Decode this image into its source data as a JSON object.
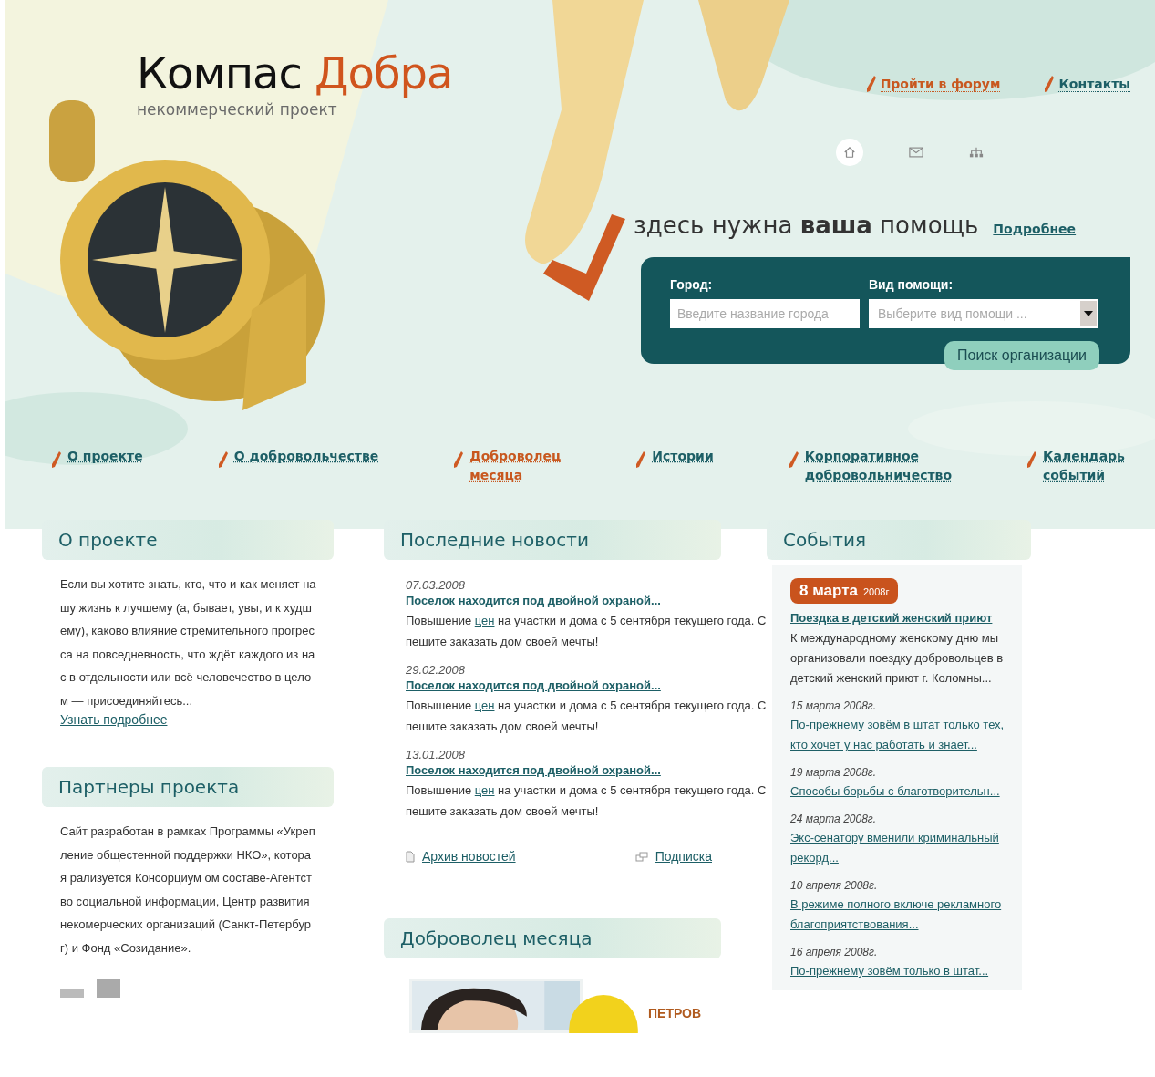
{
  "header": {
    "logo_first": "Компас",
    "logo_second": "Добра",
    "tagline": "некоммерческий проект",
    "top_links": [
      {
        "label": "Пройти в форум",
        "color": "#c8581f"
      },
      {
        "label": "Контакты",
        "color": "#1d5f66"
      }
    ],
    "help_heading": "здесь нужна **ваша** помощь",
    "help_link": "Подробнее",
    "search": {
      "city_label": "Город:",
      "city_placeholder": "Введите название города",
      "help_label": "Вид помощи:",
      "help_placeholder": "Выберите вид помощи ...",
      "button": "Поиск организации"
    }
  },
  "nav": [
    {
      "lines": [
        "О проекте"
      ],
      "selected": false
    },
    {
      "lines": [
        "О добровольчестве"
      ],
      "selected": false
    },
    {
      "lines": [
        "Доброволец",
        "месяца"
      ],
      "selected": true
    },
    {
      "lines": [
        "Истории"
      ],
      "selected": false
    },
    {
      "lines": [
        "Корпоративное",
        "добровольничество"
      ],
      "selected": false
    },
    {
      "lines": [
        "Календарь",
        "событий"
      ],
      "selected": false
    }
  ],
  "about": {
    "title": "О проекте",
    "text": "Если вы хотите знать, кто, что и как меняет нашу жизнь к лучшему (а, бывает, увы, и к худшему), каково влияние стремительного прогресса на повседневность, что ждёт каждого из нас в отдельности или всё человечество в целом — присоединяйтесь...",
    "link": "Узнать подробнее"
  },
  "partners": {
    "title": "Партнеры проекта",
    "text": "Сайт разработан в рамках Программы «Укрепление общестенной поддержки НКО», которая рализуется Консорциум ом  составе-Агентство социальной информации, Центр развития некомерческих организаций (Санкт-Петербург) и Фонд «Созидание»."
  },
  "news": {
    "title": "Последние новости",
    "items": [
      {
        "date": "07.03.2008",
        "title": "Поселок находится под двойной охраной...",
        "before": "Повышение ",
        "link": "цен",
        "after": " на участки и дома с 5 сентября текущего года. Спешите заказать дом своей мечты!"
      },
      {
        "date": "29.02.2008",
        "title": "Поселок находится под двойной охраной...",
        "before": "Повышение ",
        "link": "цен",
        "after": " на участки и дома с 5 сентября текущего года. Спешите заказать дом своей мечты!"
      },
      {
        "date": "13.01.2008",
        "title": "Поселок находится под двойной охраной...",
        "before": "Повышение ",
        "link": "цен",
        "after": " на участки и дома с 5 сентября текущего года. Спешите заказать дом своей мечты!"
      }
    ],
    "archive": "Архив новостей",
    "subscribe": "Подписка"
  },
  "volunteer": {
    "title": "Доброволец месяца",
    "name": "ПЕТРОВ"
  },
  "events": {
    "title": "События",
    "featured": {
      "day": "8 марта",
      "year": "2008г",
      "title": "Поездка в детский женский приют",
      "text": "К международному женскому дню мы организовали поездку добровольцев в детский женский приют г. Коломны..."
    },
    "items": [
      {
        "date": "15 марта 2008г.",
        "title": "По-прежнему зовём в штат только тех, кто хочет у нас работать и знает..."
      },
      {
        "date": "19 марта 2008г.",
        "title": "Способы борьбы с благотворительн..."
      },
      {
        "date": "24 марта 2008г.",
        "title": "Экс-сенатору вменили криминальный рекорд..."
      },
      {
        "date": "10 апреля 2008г.",
        "title": "В режиме полного включе рекламного благоприятствования..."
      },
      {
        "date": "16 апреля 2008г.",
        "title": "По-прежнему зовём только в штат..."
      }
    ]
  }
}
